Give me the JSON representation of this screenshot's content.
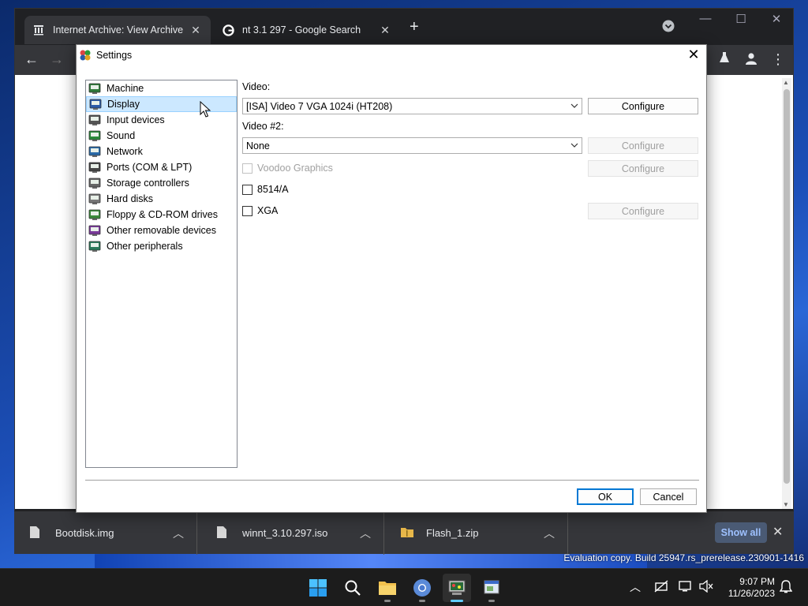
{
  "browser": {
    "tabs": [
      {
        "title": "Internet Archive: View Archive",
        "icon": "archive-icon",
        "active": true
      },
      {
        "title": "nt 3.1 297 - Google Search",
        "icon": "google-icon",
        "active": false
      }
    ],
    "new_tab": "+"
  },
  "dialog": {
    "title": "Settings",
    "tree": [
      {
        "label": "Machine",
        "icon": "machine-icon",
        "color": "#2f7a3a"
      },
      {
        "label": "Display",
        "icon": "display-icon",
        "color": "#2a5aa8"
      },
      {
        "label": "Input devices",
        "icon": "input-devices-icon",
        "color": "#555555"
      },
      {
        "label": "Sound",
        "icon": "sound-icon",
        "color": "#2a8a3a"
      },
      {
        "label": "Network",
        "icon": "network-icon",
        "color": "#2a6aa8"
      },
      {
        "label": "Ports (COM & LPT)",
        "icon": "ports-icon",
        "color": "#444444"
      },
      {
        "label": "Storage controllers",
        "icon": "storage-controllers-icon",
        "color": "#666666"
      },
      {
        "label": "Hard disks",
        "icon": "hard-disks-icon",
        "color": "#777777"
      },
      {
        "label": "Floppy & CD-ROM drives",
        "icon": "floppy-cdrom-icon",
        "color": "#3a8a3a"
      },
      {
        "label": "Other removable devices",
        "icon": "removable-devices-icon",
        "color": "#7a3a9a"
      },
      {
        "label": "Other peripherals",
        "icon": "peripherals-icon",
        "color": "#2a7a5a"
      }
    ],
    "selected": "Display",
    "video_label": "Video:",
    "video_value": "[ISA] Video 7 VGA 1024i (HT208)",
    "video2_label": "Video #2:",
    "video2_value": "None",
    "configure_label": "Configure",
    "voodoo_label": "Voodoo Graphics",
    "ibm8514_label": "8514/A",
    "xga_label": "XGA",
    "ok_label": "OK",
    "cancel_label": "Cancel"
  },
  "downloads": {
    "items": [
      {
        "name": "Bootdisk.img",
        "icon": "file-icon"
      },
      {
        "name": "winnt_3.10.297.iso",
        "icon": "file-icon"
      },
      {
        "name": "Flash_1.zip",
        "icon": "zip-folder-icon"
      }
    ],
    "show_all": "Show all"
  },
  "desktop": {
    "eval_text": "Evaluation copy. Build 25947.rs_prerelease.230901-1416"
  },
  "taskbar": {
    "time": "9:07 PM",
    "date": "11/26/2023"
  }
}
